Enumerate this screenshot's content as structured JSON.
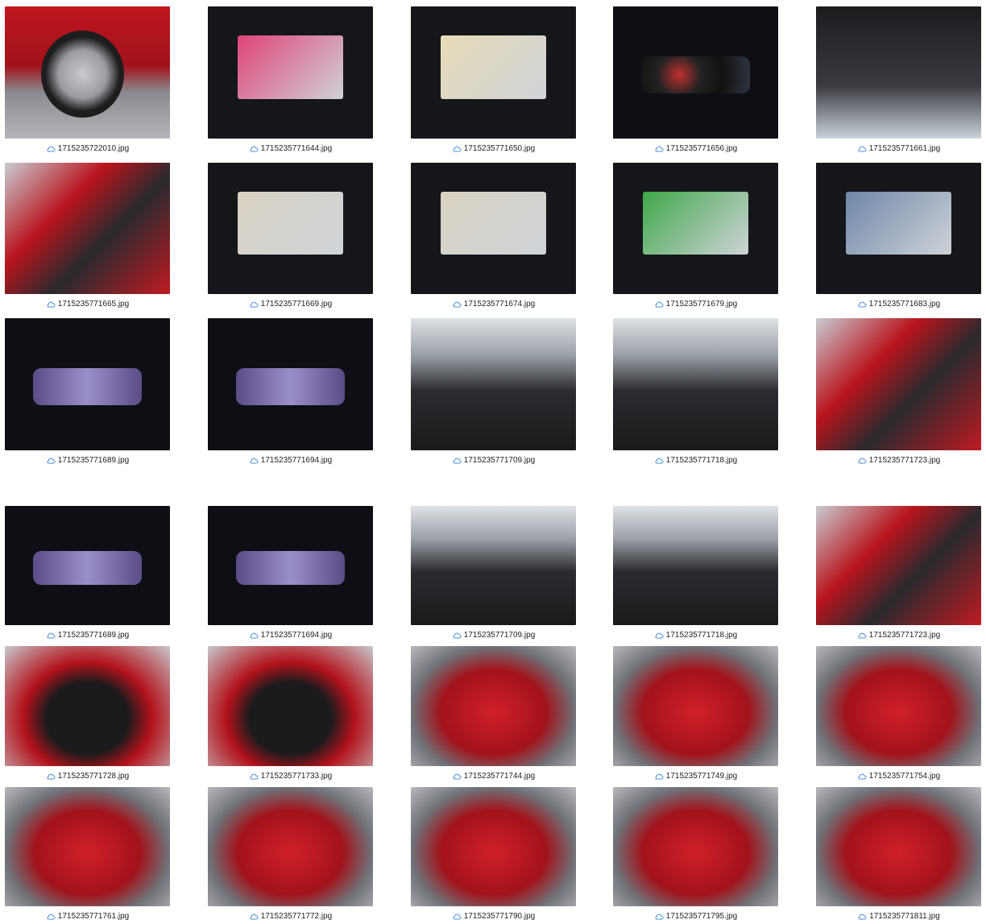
{
  "grid_top": [
    {
      "file": "1715235722010.jpg",
      "motif": "wheel",
      "icon": "cloud-icon"
    },
    {
      "file": "1715235771644.jpg",
      "motif": "screen",
      "accent": "#e0447a",
      "icon": "cloud-icon"
    },
    {
      "file": "1715235771650.jpg",
      "motif": "screen",
      "accent": "#e8dcb8",
      "icon": "cloud-icon"
    },
    {
      "file": "1715235771656.jpg",
      "motif": "cluster-gauge",
      "icon": "cloud-icon"
    },
    {
      "file": "1715235771661.jpg",
      "motif": "roof",
      "icon": "cloud-icon"
    },
    {
      "file": "1715235771665.jpg",
      "motif": "door",
      "icon": "cloud-icon"
    },
    {
      "file": "1715235771669.jpg",
      "motif": "screen",
      "accent": "#d9d2c2",
      "icon": "cloud-icon"
    },
    {
      "file": "1715235771674.jpg",
      "motif": "screen",
      "accent": "#d9d2c2",
      "icon": "cloud-icon"
    },
    {
      "file": "1715235771679.jpg",
      "motif": "screen",
      "accent": "#3fa84a",
      "icon": "cloud-icon"
    },
    {
      "file": "1715235771683.jpg",
      "motif": "screen",
      "accent": "#6e86a8",
      "icon": "cloud-icon"
    },
    {
      "file": "1715235771689.jpg",
      "motif": "cluster",
      "icon": "cloud-icon"
    },
    {
      "file": "1715235771694.jpg",
      "motif": "cluster",
      "icon": "cloud-icon"
    },
    {
      "file": "1715235771709.jpg",
      "motif": "interior",
      "icon": "cloud-icon"
    },
    {
      "file": "1715235771718.jpg",
      "motif": "interior",
      "icon": "cloud-icon"
    },
    {
      "file": "1715235771723.jpg",
      "motif": "door",
      "icon": "cloud-icon"
    }
  ],
  "grid_bottom": [
    {
      "file": "1715235771689.jpg",
      "motif": "cluster",
      "icon": "cloud-icon"
    },
    {
      "file": "1715235771694.jpg",
      "motif": "cluster",
      "icon": "cloud-icon"
    },
    {
      "file": "1715235771709.jpg",
      "motif": "interior",
      "icon": "cloud-icon"
    },
    {
      "file": "1715235771718.jpg",
      "motif": "interior",
      "icon": "cloud-icon"
    },
    {
      "file": "1715235771723.jpg",
      "motif": "door",
      "icon": "cloud-icon"
    },
    {
      "file": "1715235771728.jpg",
      "motif": "trunk",
      "icon": "cloud-icon"
    },
    {
      "file": "1715235771733.jpg",
      "motif": "trunk",
      "icon": "cloud-icon"
    },
    {
      "file": "1715235771744.jpg",
      "motif": "car",
      "icon": "cloud-icon"
    },
    {
      "file": "1715235771749.jpg",
      "motif": "car",
      "icon": "cloud-icon"
    },
    {
      "file": "1715235771754.jpg",
      "motif": "car",
      "icon": "cloud-icon"
    },
    {
      "file": "1715235771761.jpg",
      "motif": "car",
      "icon": "cloud-icon"
    },
    {
      "file": "1715235771772.jpg",
      "motif": "car",
      "icon": "cloud-icon"
    },
    {
      "file": "1715235771790.jpg",
      "motif": "car",
      "icon": "cloud-icon"
    },
    {
      "file": "1715235771795.jpg",
      "motif": "car",
      "icon": "cloud-icon"
    },
    {
      "file": "1715235771811.jpg",
      "motif": "car",
      "icon": "cloud-icon"
    }
  ]
}
